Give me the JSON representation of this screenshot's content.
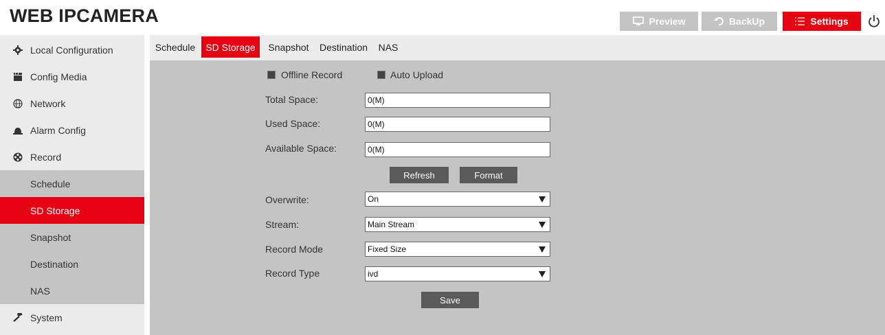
{
  "app": {
    "title": "WEB IPCAMERA"
  },
  "header": {
    "preview_label": "Preview",
    "backup_label": "BackUp",
    "settings_label": "Settings"
  },
  "sidebar": {
    "items": [
      {
        "label": "Local Configuration",
        "icon": "gear-icon"
      },
      {
        "label": "Config Media",
        "icon": "clapperboard-icon"
      },
      {
        "label": "Network",
        "icon": "globe-icon"
      },
      {
        "label": "Alarm Config",
        "icon": "alarm-bell-icon"
      },
      {
        "label": "Record",
        "icon": "film-reel-icon"
      },
      {
        "label": "System",
        "icon": "wrench-icon"
      }
    ],
    "record_subitems": [
      "Schedule",
      "SD Storage",
      "Snapshot",
      "Destination",
      "NAS"
    ]
  },
  "tabs": [
    "Schedule",
    "SD Storage",
    "Snapshot",
    "Destination",
    "NAS"
  ],
  "form": {
    "offline_record_label": "Offline Record",
    "auto_upload_label": "Auto Upload",
    "total_space_label": "Total Space:",
    "total_space_value": "0(M)",
    "used_space_label": "Used Space:",
    "used_space_value": "0(M)",
    "available_space_label": "Available Space:",
    "available_space_value": "0(M)",
    "refresh_label": "Refresh",
    "format_label": "Format",
    "overwrite_label": "Overwrite:",
    "overwrite_value": "On",
    "stream_label": "Stream:",
    "stream_value": "Main Stream",
    "record_mode_label": "Record Mode",
    "record_mode_value": "Fixed Size",
    "record_type_label": "Record Type",
    "record_type_value": "ivd",
    "save_label": "Save"
  },
  "colors": {
    "accent": "#e50012",
    "header_button": "#c4c4c4",
    "panel": "#c4c4c4",
    "sidebar": "#ececec",
    "button": "#5a5a5a"
  }
}
